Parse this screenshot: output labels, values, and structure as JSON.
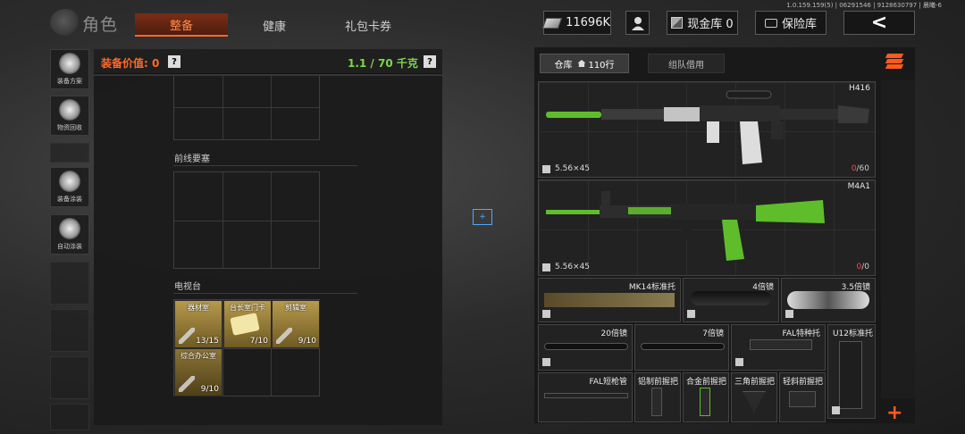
{
  "version": "1.0.159.159(5) | 06291546 | 9128630797 | 晨曦-6",
  "header": {
    "title": "角色",
    "tabs": [
      {
        "label": "整备",
        "active": true
      },
      {
        "label": "健康",
        "active": false
      },
      {
        "label": "礼包卡券",
        "active": false
      }
    ],
    "money": "11696K",
    "cash_vault": "现金库 0",
    "safe": "保险库",
    "back": "<"
  },
  "sidebar": {
    "items": [
      {
        "label": "装备方案"
      },
      {
        "label": "物资回收"
      },
      {
        "label": "装备涂装"
      },
      {
        "label": "自动涂装"
      }
    ]
  },
  "left_panel": {
    "value_label": "装备价值: 0",
    "weight": "1.1 / 70 千克",
    "help": "?",
    "sections": [
      {
        "title": "前线要塞"
      },
      {
        "title": "电视台"
      }
    ],
    "keys": [
      {
        "name": "器材室",
        "count": "13/15"
      },
      {
        "name": "台长室门卡",
        "count": "7/10"
      },
      {
        "name": "剪辑室",
        "count": "9/10"
      },
      {
        "name": "综合办公室",
        "count": "9/10"
      }
    ]
  },
  "focus_mark": "+",
  "right_panel": {
    "tabs": [
      {
        "label": "仓库",
        "extra": "110行",
        "active": true
      },
      {
        "label": "组队借用",
        "active": false
      }
    ],
    "plus": "+",
    "items": [
      {
        "name": "H416",
        "caliber": "5.56×45",
        "ammo_current": "0",
        "ammo_total": "/60"
      },
      {
        "name": "M4A1",
        "caliber": "5.56×45",
        "ammo_current": "0",
        "ammo_total": "/0"
      },
      {
        "name": "MK14标准托"
      },
      {
        "name": "4倍镜"
      },
      {
        "name": "3.5倍镜"
      },
      {
        "name": "20倍镜"
      },
      {
        "name": "7倍镜"
      },
      {
        "name": "FAL特种托"
      },
      {
        "name": "U12标准托"
      },
      {
        "name": "FAL短枪管"
      },
      {
        "name": "铝制前握把"
      },
      {
        "name": "合金前握把"
      },
      {
        "name": "三角前握把"
      },
      {
        "name": "轻斜前握把"
      }
    ]
  }
}
